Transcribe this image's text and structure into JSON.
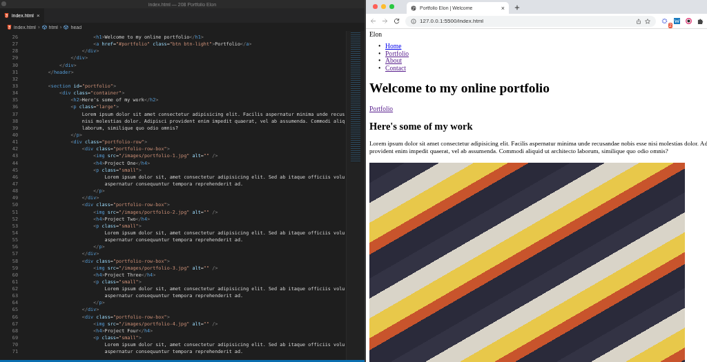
{
  "editor": {
    "window_title": "index.html — 208 Portfolio Elon",
    "tabs": [
      {
        "label": "index.html",
        "selected": true,
        "close": "×"
      }
    ],
    "breadcrumb": [
      "index.html",
      "html",
      "head"
    ],
    "breadcrumb_separator": "›",
    "lines": [
      {
        "number": "26",
        "code": "                        <h1>Welcome to my online portfolio</h1>"
      },
      {
        "number": "27",
        "code": "                        <a href=\"#portfolio\" class=\"btn btn-light\">Portfolio</a>"
      },
      {
        "number": "28",
        "code": "                    </div>"
      },
      {
        "number": "29",
        "code": "                </div>"
      },
      {
        "number": "30",
        "code": "            </div>"
      },
      {
        "number": "31",
        "code": "        </header>"
      },
      {
        "number": "32"
      },
      {
        "number": "33",
        "code": "        <section id=\"portfolio\">"
      },
      {
        "number": "34",
        "code": "            <div class=\"container\">"
      },
      {
        "number": "35",
        "code": "                <h2>Here's some of my work</h2>"
      },
      {
        "number": "36",
        "code": "                <p class=\"large\">"
      },
      {
        "number": "37",
        "code": "                    Lorem ipsum dolor sit amet consectetur adipisicing elit. Facilis aspernatur minima unde recus"
      },
      {
        "number": "38",
        "code": "                    nisi molestias dolor. Adipisci provident enim impedit quaerat, vel ab assumenda. Commodi aliq"
      },
      {
        "number": "39",
        "code": "                    laborum, similique quo odio omnis?"
      },
      {
        "number": "40",
        "code": "                </p>"
      },
      {
        "number": "41",
        "code": "                <div class=\"portfolio-row\">"
      },
      {
        "number": "42",
        "code": "                    <div class=\"portfolio-row-box\">"
      },
      {
        "number": "43",
        "code": "                        <img src=\"/images/portfolio-1.jpg\" alt=\"\" />"
      },
      {
        "number": "44",
        "code": "                        <h4>Project One</h4>"
      },
      {
        "number": "45",
        "code": "                        <p class=\"small\">"
      },
      {
        "number": "46",
        "code": "                            Lorem ipsum dolor sit, amet consectetur adipisicing elit. Sed ab itaque officiis volu"
      },
      {
        "number": "47",
        "code": "                            aspernatur consequuntur tempora reprehenderit ad."
      },
      {
        "number": "48",
        "code": "                        </p>"
      },
      {
        "number": "49",
        "code": "                    </div>"
      },
      {
        "number": "50",
        "code": "                    <div class=\"portfolio-row-box\">"
      },
      {
        "number": "51",
        "code": "                        <img src=\"/images/portfolio-2.jpg\" alt=\"\" />"
      },
      {
        "number": "52",
        "code": "                        <h4>Project Two</h4>"
      },
      {
        "number": "53",
        "code": "                        <p class=\"small\">"
      },
      {
        "number": "54",
        "code": "                            Lorem ipsum dolor sit, amet consectetur adipisicing elit. Sed ab itaque officiis volu"
      },
      {
        "number": "55",
        "code": "                            aspernatur consequuntur tempora reprehenderit ad."
      },
      {
        "number": "56",
        "code": "                        </p>"
      },
      {
        "number": "57",
        "code": "                    </div>"
      },
      {
        "number": "58",
        "code": "                    <div class=\"portfolio-row-box\">"
      },
      {
        "number": "59",
        "code": "                        <img src=\"/images/portfolio-3.jpg\" alt=\"\" />"
      },
      {
        "number": "60",
        "code": "                        <h4>Project Three</h4>"
      },
      {
        "number": "61",
        "code": "                        <p class=\"small\">"
      },
      {
        "number": "62",
        "code": "                            Lorem ipsum dolor sit, amet consectetur adipisicing elit. Sed ab itaque officiis volu"
      },
      {
        "number": "63",
        "code": "                            aspernatur consequuntur tempora reprehenderit ad."
      },
      {
        "number": "64",
        "code": "                        </p>"
      },
      {
        "number": "65",
        "code": "                    </div>"
      },
      {
        "number": "66",
        "code": "                    <div class=\"portfolio-row-box\">"
      },
      {
        "number": "67",
        "code": "                        <img src=\"/images/portfolio-4.jpg\" alt=\"\" />"
      },
      {
        "number": "68",
        "code": "                        <h4>Project Four</h4>"
      },
      {
        "number": "69",
        "code": "                        <p class=\"small\">"
      },
      {
        "number": "70",
        "code": "                            Lorem ipsum dolor sit, amet consectetur adipisicing elit. Sed ab itaque officiis volu"
      },
      {
        "number": "71",
        "code": "                            aspernatur consequuntur tempora reprehenderit ad."
      }
    ]
  },
  "browser": {
    "tabs": [
      {
        "label": "Portfolio Elon | Welcome",
        "selected": true,
        "close": "×"
      }
    ],
    "url": "127.0.0.1:5500/index.html",
    "extension_badge": "2",
    "page": {
      "brand": "Elon",
      "nav": [
        {
          "marker": "•",
          "label": "Home",
          "visited": false
        },
        {
          "marker": "•",
          "label": "Portfolio",
          "visited": true
        },
        {
          "marker": "•",
          "label": "About",
          "visited": true
        },
        {
          "marker": "•",
          "label": "Contact",
          "visited": true
        }
      ],
      "heading": "Welcome to my online portfolio",
      "link": {
        "label": "Portfolio",
        "visited": true
      },
      "subheading": "Here's some of my work",
      "paragraph_lines": [
        "Lorem ipsum dolor sit amet consectetur adipisicing elit. Facilis aspernatur minima unde recusandae nobis esse nisi molestias dolor. Ad",
        "provident enim impedit quaerat, vel ab assumenda. Commodi aliquid ut architecto laborum, similique quo odio omnis?"
      ]
    }
  }
}
